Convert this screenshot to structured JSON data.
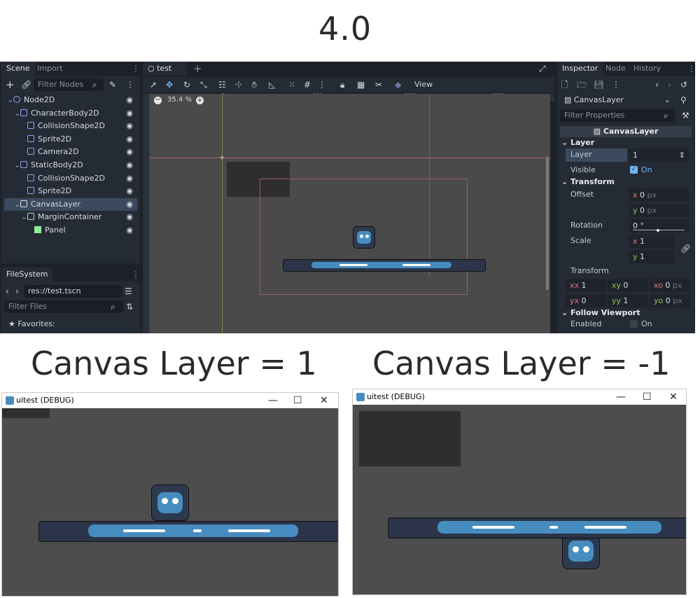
{
  "headline": "4.0",
  "caption_left": "Canvas Layer = 1",
  "caption_right": "Canvas Layer = -1",
  "editor": {
    "scene_dock": {
      "tabs": [
        "Scene",
        "Import"
      ],
      "filter_placeholder": "Filter Nodes",
      "tree": [
        {
          "name": "Node2D",
          "depth": 0,
          "icon": "node2d-icon",
          "color": "#8da5f3"
        },
        {
          "name": "CharacterBody2D",
          "depth": 1,
          "icon": "characterbody2d-icon",
          "color": "#8da5f3"
        },
        {
          "name": "CollisionShape2D",
          "depth": 2,
          "icon": "collisionshape2d-icon",
          "color": "#8da5f3"
        },
        {
          "name": "Sprite2D",
          "depth": 2,
          "icon": "sprite2d-icon",
          "color": "#8da5f3"
        },
        {
          "name": "Camera2D",
          "depth": 2,
          "icon": "camera2d-icon",
          "color": "#8da5f3"
        },
        {
          "name": "StaticBody2D",
          "depth": 1,
          "icon": "staticbody2d-icon",
          "color": "#8da5f3"
        },
        {
          "name": "CollisionShape2D",
          "depth": 2,
          "icon": "collisionshape2d-icon",
          "color": "#8da5f3"
        },
        {
          "name": "Sprite2D",
          "depth": 2,
          "icon": "sprite2d-icon",
          "color": "#8da5f3"
        },
        {
          "name": "CanvasLayer",
          "depth": 1,
          "icon": "canvaslayer-icon",
          "color": "#e0e0e0",
          "selected": true
        },
        {
          "name": "MarginContainer",
          "depth": 2,
          "icon": "margincontainer-icon",
          "color": "#8eef97"
        },
        {
          "name": "Panel",
          "depth": 3,
          "icon": "panel-icon",
          "color": "#8eef97"
        }
      ]
    },
    "filesystem_dock": {
      "tab": "FileSystem",
      "path": "res://test.tscn",
      "filter_placeholder": "Filter Files",
      "favorites": "Favorites:"
    },
    "scene_tab": "test",
    "toolbar_view": "View",
    "zoom": "35.4 %",
    "ruler_marks": [
      "0",
      "500",
      "1000",
      "1500"
    ],
    "inspector": {
      "tabs": [
        "Inspector",
        "Node",
        "History"
      ],
      "object": "CanvasLayer",
      "filter_placeholder": "Filter Properties",
      "class_header": "CanvasLayer",
      "sections": {
        "layer": "Layer",
        "transform": "Transform",
        "follow": "Follow Viewport"
      },
      "props": {
        "layer_label": "Layer",
        "layer_value": "1",
        "visible_label": "Visible",
        "visible_value": "On",
        "offset_label": "Offset",
        "offset_x": "0",
        "offset_y": "0",
        "rotation_label": "Rotation",
        "rotation_value": "0 °",
        "scale_label": "Scale",
        "scale_x": "1",
        "scale_y": "1",
        "transform_label": "Transform",
        "xx": "1",
        "xy": "0",
        "xo": "0",
        "yx": "0",
        "yy": "1",
        "yo": "0",
        "enabled_label": "Enabled",
        "enabled_value": "On",
        "unit_px": "px"
      }
    }
  },
  "window_left": {
    "title": "uitest (DEBUG)"
  },
  "window_right": {
    "title": "uitest (DEBUG)"
  },
  "colors": {
    "accent": "#478cbf",
    "selection": "#3b4a5e",
    "check": "#6fb5ff"
  }
}
